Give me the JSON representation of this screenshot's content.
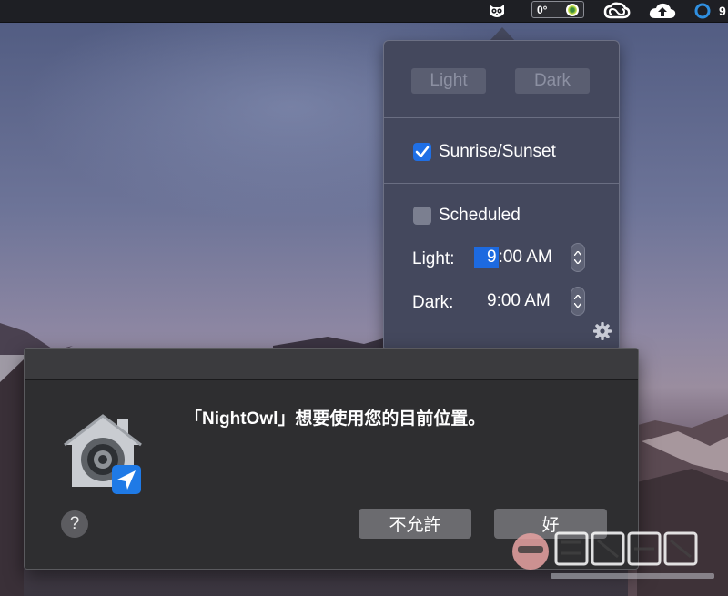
{
  "menubar": {
    "icons": [
      "owl-icon",
      "thermometer-widget",
      "creative-cloud-icon",
      "cloud-upload-icon",
      "ring-icon"
    ],
    "temperature": "0°",
    "clipped_text": "9"
  },
  "popover": {
    "light_button": "Light",
    "dark_button": "Dark",
    "sunrise_sunset": {
      "label": "Sunrise/Sunset",
      "checked": true
    },
    "scheduled": {
      "label": "Scheduled",
      "checked": false
    },
    "light_row": {
      "label": "Light:",
      "hour": "9",
      "rest": ":00 AM"
    },
    "dark_row": {
      "label": "Dark:",
      "value": "9:00 AM"
    },
    "settings_icon": "gear-icon"
  },
  "dialog": {
    "message": "「NightOwl」想要使用您的目前位置。",
    "icon": "location-house-icon",
    "help_label": "?",
    "deny_button": "不允許",
    "allow_button": "好"
  },
  "colors": {
    "accent": "#1f6fe5",
    "menubar_bg": "#1e1f24",
    "popover_bg": "#44485d",
    "dialog_bg": "#2e2e30"
  }
}
